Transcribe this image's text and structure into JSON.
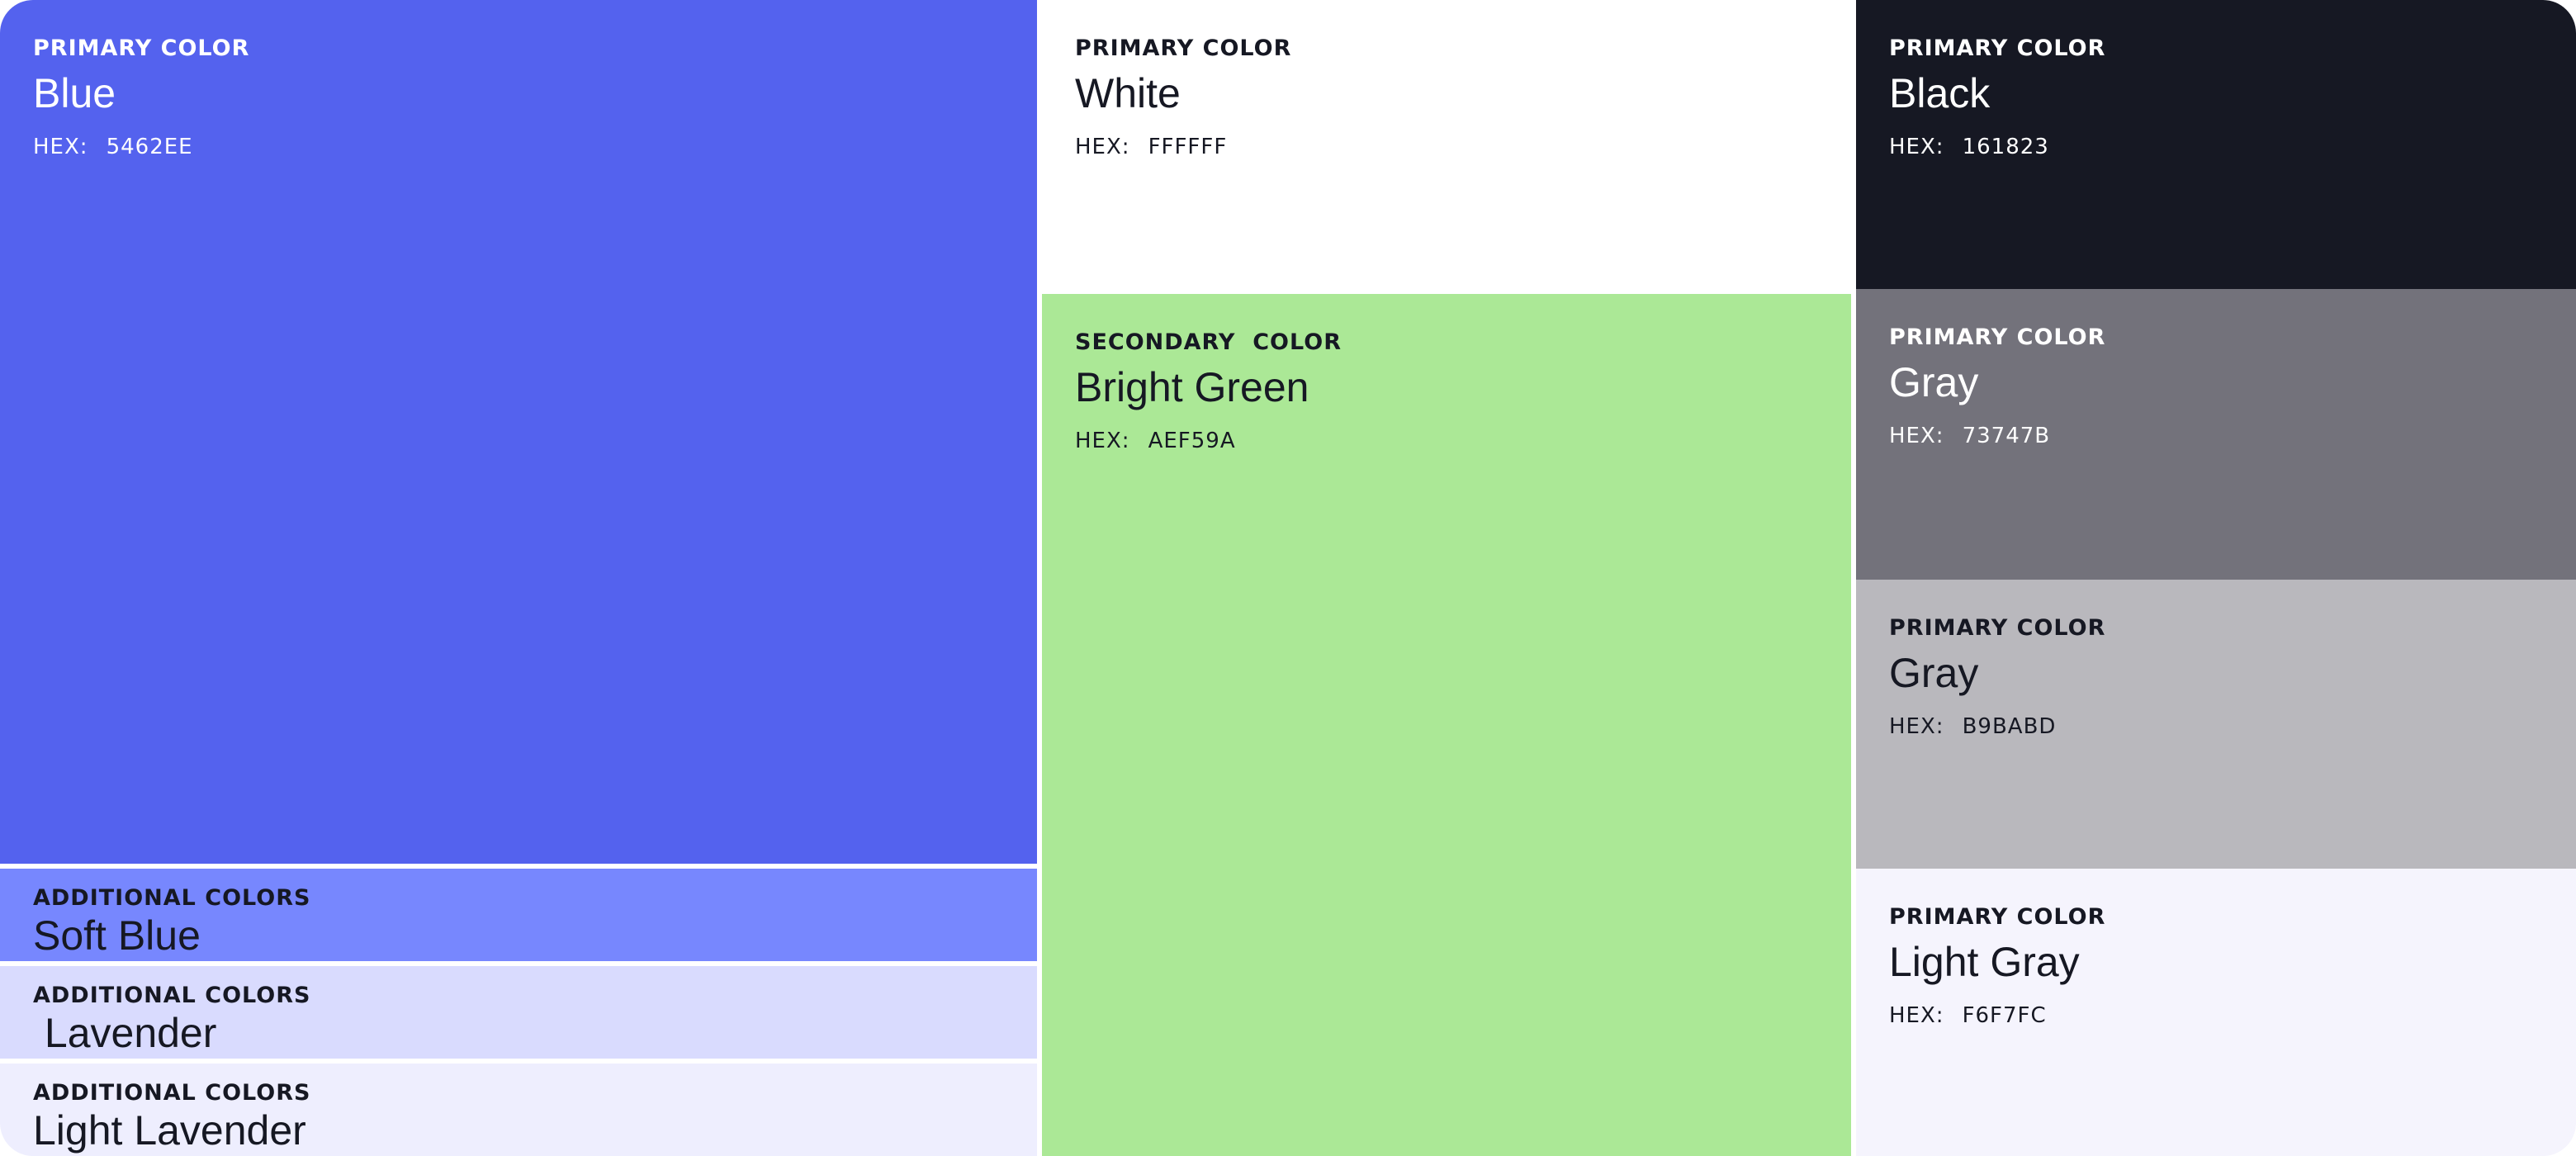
{
  "swatches": {
    "blue": {
      "label": "PRIMARY COLOR",
      "name": "Blue",
      "hex_prefix": "HEX:",
      "hex": "5462EE",
      "color": "#5462EE",
      "text": "#ffffff"
    },
    "soft_blue": {
      "label": "ADDITIONAL COLORS",
      "name": "Soft Blue",
      "color": "#7787FE",
      "text": "#161823"
    },
    "lavender": {
      "label": "ADDITIONAL COLORS",
      "name": " Lavender",
      "color": "#D9DBFE",
      "text": "#161823"
    },
    "light_lavender": {
      "label": "ADDITIONAL COLORS",
      "name": "Light Lavender",
      "color": "#EEEEFE",
      "text": "#161823"
    },
    "white": {
      "label": "PRIMARY COLOR",
      "name": "White",
      "hex_prefix": "HEX:",
      "hex": "FFFFFF",
      "color": "#FFFFFF",
      "text": "#161823"
    },
    "bright_green": {
      "label": "SECONDARY  COLOR",
      "name": "Bright Green",
      "hex_prefix": "HEX:",
      "hex": "AEF59A",
      "color": "#ABE896",
      "text": "#161823"
    },
    "black": {
      "label": "PRIMARY COLOR",
      "name": "Black",
      "hex_prefix": "HEX:",
      "hex": "161823",
      "color": "#161823",
      "text": "#ffffff"
    },
    "gray_dark": {
      "label": "PRIMARY COLOR",
      "name": "Gray",
      "hex_prefix": "HEX:",
      "hex": "73747B",
      "color": "#73727B",
      "text": "#ffffff"
    },
    "gray_light": {
      "label": "PRIMARY COLOR",
      "name": "Gray",
      "hex_prefix": "HEX:",
      "hex": "B9BABD",
      "color": "#B9B8BD",
      "text": "#161823"
    },
    "light_gray": {
      "label": "PRIMARY COLOR",
      "name": "Light Gray",
      "hex_prefix": "HEX:",
      "hex": "F6F7FC",
      "color": "#F5F4FD",
      "text": "#161823"
    }
  }
}
